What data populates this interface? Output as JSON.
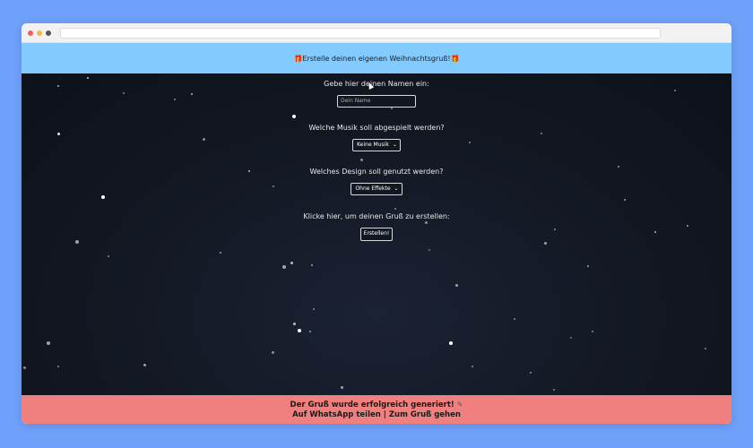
{
  "header": {
    "title": "Erstelle deinen eigenen Weihnachtsgruß!",
    "icon_left": "gift-icon",
    "icon_right": "gift-icon"
  },
  "form": {
    "name_label": "Gebe hier deinen Namen ein:",
    "name_placeholder": "Dein Name",
    "music_label": "Welche Musik soll abgespielt werden?",
    "music_value": "Keine Musik",
    "design_label": "Welches Design soll genutzt werden?",
    "design_value": "Ohne Effekte",
    "create_label": "Klicke hier, um deinen Gruß zu erstellen:",
    "create_button": "Erstellen!"
  },
  "footer": {
    "success": "Der Gruß wurde erfolgreich generiert!",
    "success_icon": "pencil-icon",
    "share_link": "Auf WhatsApp teilen",
    "separator": "|",
    "view_link": "Zum Gruß gehen"
  },
  "colors": {
    "page_bg": "#6fa1fb",
    "header_bg": "#83cafe",
    "content_bg": "#121722",
    "footer_bg": "#f08080"
  }
}
